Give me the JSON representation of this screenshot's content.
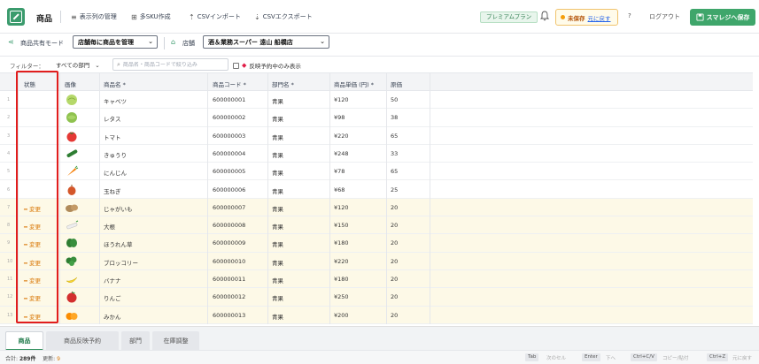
{
  "header": {
    "app_title": "商品",
    "buttons": [
      {
        "id": "columns",
        "icon": "list-icon",
        "label": "表示列の管理"
      },
      {
        "id": "multisku",
        "icon": "grid-icon",
        "label": "多SKU作成"
      },
      {
        "id": "import",
        "icon": "upload-icon",
        "label": "CSVインポート"
      },
      {
        "id": "export",
        "icon": "download-icon",
        "label": "CSVエクスポート"
      }
    ],
    "plan_badge": "プレミアムプラン",
    "unsaved_label": "未保存",
    "undo_label": "元に戻す",
    "help_label": "?",
    "logout_label": "ログアウト",
    "save_label": "スマレジへ保存"
  },
  "toolbar": {
    "share_mode_label": "商品共有モード",
    "share_mode_value": "店舗毎に商品を管理",
    "store_label": "店舗",
    "store_value": "酒＆業務スーパー 遠山 船橋店"
  },
  "filter": {
    "label": "フィルター：",
    "department_value": "すべての部門",
    "search_placeholder": "商品名・商品コードで絞り込み",
    "reserved_only_label": "反映予約中のみ表示"
  },
  "grid": {
    "columns": [
      "状態",
      "画像",
      "商品名 *",
      "商品コード *",
      "部門名 *",
      "商品単価 (円) *",
      "原価"
    ],
    "rows": [
      {
        "num": "1",
        "status": "",
        "image": "cabbage-icon",
        "name": "キャベツ",
        "code": "600000001",
        "dept": "青果",
        "price": "¥120",
        "cost": "50"
      },
      {
        "num": "2",
        "status": "",
        "image": "lettuce-icon",
        "name": "レタス",
        "code": "600000002",
        "dept": "青果",
        "price": "¥98",
        "cost": "38"
      },
      {
        "num": "3",
        "status": "",
        "image": "tomato-icon",
        "name": "トマト",
        "code": "600000003",
        "dept": "青果",
        "price": "¥220",
        "cost": "65"
      },
      {
        "num": "4",
        "status": "",
        "image": "cucumber-icon",
        "name": "きゅうり",
        "code": "600000004",
        "dept": "青果",
        "price": "¥248",
        "cost": "33"
      },
      {
        "num": "5",
        "status": "",
        "image": "carrot-icon",
        "name": "にんじん",
        "code": "600000005",
        "dept": "青果",
        "price": "¥78",
        "cost": "65"
      },
      {
        "num": "6",
        "status": "",
        "image": "onion-icon",
        "name": "玉ねぎ",
        "code": "600000006",
        "dept": "青果",
        "price": "¥68",
        "cost": "25"
      },
      {
        "num": "7",
        "status": "━ 変更",
        "image": "potato-icon",
        "name": "じゃがいも",
        "code": "600000007",
        "dept": "青果",
        "price": "¥120",
        "cost": "20"
      },
      {
        "num": "8",
        "status": "━ 変更",
        "image": "daikon-icon",
        "name": "大根",
        "code": "600000008",
        "dept": "青果",
        "price": "¥150",
        "cost": "20"
      },
      {
        "num": "9",
        "status": "━ 変更",
        "image": "spinach-icon",
        "name": "ほうれん草",
        "code": "600000009",
        "dept": "青果",
        "price": "¥180",
        "cost": "20"
      },
      {
        "num": "10",
        "status": "━ 変更",
        "image": "broccoli-icon",
        "name": "ブロッコリー",
        "code": "600000010",
        "dept": "青果",
        "price": "¥220",
        "cost": "20"
      },
      {
        "num": "11",
        "status": "━ 変更",
        "image": "banana-icon",
        "name": "バナナ",
        "code": "600000011",
        "dept": "青果",
        "price": "¥180",
        "cost": "20"
      },
      {
        "num": "12",
        "status": "━ 変更",
        "image": "apple-icon",
        "name": "りんご",
        "code": "600000012",
        "dept": "青果",
        "price": "¥250",
        "cost": "20"
      },
      {
        "num": "13",
        "status": "━ 変更",
        "image": "orange-icon",
        "name": "みかん",
        "code": "600000013",
        "dept": "青果",
        "price": "¥200",
        "cost": "20"
      }
    ]
  },
  "tabs": [
    {
      "label": "商品",
      "active": true
    },
    {
      "label": "商品反映予約",
      "active": false
    },
    {
      "label": "部門",
      "active": false
    },
    {
      "label": "在庫調整",
      "active": false
    }
  ],
  "status_bar": {
    "total_label": "合計:",
    "total_value": "289件",
    "updated_label": "更新:",
    "updated_value": "9",
    "shortcuts": [
      {
        "key": "Tab",
        "desc": "次のセル"
      },
      {
        "key": "Enter",
        "desc": "下へ"
      },
      {
        "key": "Ctrl+C/V",
        "desc": "コピー/貼付"
      },
      {
        "key": "Ctrl+Z",
        "desc": "元に戻す"
      }
    ]
  },
  "colors": {
    "brand_green": "#3fa66b",
    "changed_row_bg": "#fdf9e7",
    "changed_text": "#d97706",
    "highlight_red": "#e11d1d"
  }
}
